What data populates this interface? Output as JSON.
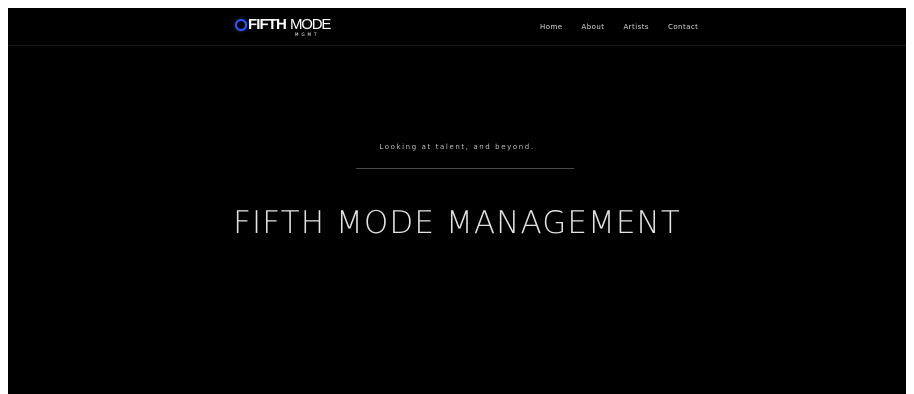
{
  "logo": {
    "fifth": "FIFTH",
    "mode": "MODE",
    "sub": "MGMT",
    "accent": "#2f56ff",
    "icon": "circle-icon"
  },
  "nav": {
    "home": "Home",
    "about": "About",
    "artists": "Artists",
    "contact": "Contact"
  },
  "hero": {
    "tagline": "Looking at talent, and beyond.",
    "title": "FIFTH MODE MANAGEMENT"
  },
  "colors": {
    "background": "#000000",
    "text": "#e3e3e3",
    "nav_text": "#d8d8d8"
  }
}
